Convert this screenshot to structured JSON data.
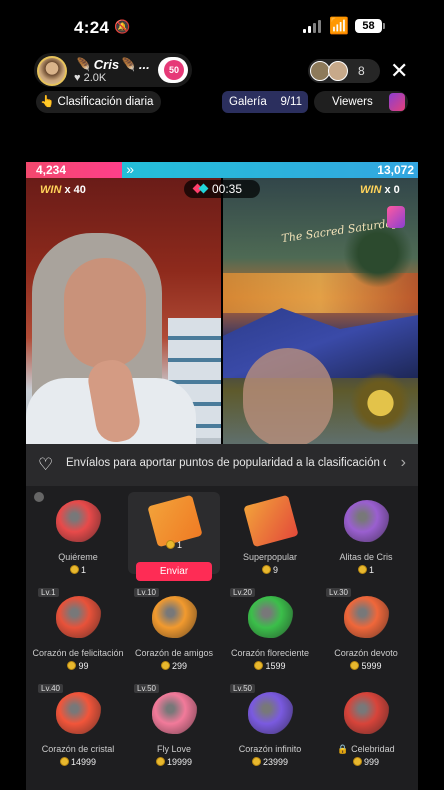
{
  "status_bar": {
    "time": "4:24",
    "battery": "58"
  },
  "host": {
    "name": "🪶 Cris🪶 ...",
    "likes": "♥ 2.0K",
    "badge": "50"
  },
  "viewers": {
    "count": "8"
  },
  "ranking": {
    "label": "👆 Clasificación diaria"
  },
  "gallery": {
    "label": "Galería",
    "progress": "9/11"
  },
  "viewers_pill": {
    "label": "Viewers"
  },
  "battle": {
    "left_score": "4,234",
    "right_score": "13,072",
    "left_share": 0.245,
    "timer": "00:35",
    "left_win_label": "WIN",
    "left_win_count": "x 40",
    "right_win_label": "WIN",
    "right_win_count": "x 0",
    "painting_text": "The Sacred Saturday"
  },
  "panel": {
    "info": "Envíalos para aportar puntos de popularidad a la clasificación d",
    "send_label": "Enviar",
    "gifts": [
      {
        "name": "Quiéreme",
        "price": "1",
        "level": "",
        "icon": "heart-face-icon",
        "color": "#e84a4a"
      },
      {
        "name": "",
        "price": "1",
        "level": "",
        "icon": "popular-arrow-icon",
        "color": "#f07b24",
        "selected": true
      },
      {
        "name": "Superpopular",
        "price": "9",
        "level": "",
        "icon": "super-popular-icon",
        "color": "#e34a3a"
      },
      {
        "name": "Alitas de Cris",
        "price": "1",
        "level": "",
        "icon": "winged-heart-icon",
        "color": "#9a5fd0"
      },
      {
        "name": "Corazón de felicitación",
        "price": "99",
        "level": "Lv.1",
        "icon": "congrats-heart-icon",
        "color": "#e8523a"
      },
      {
        "name": "Corazón de amigos",
        "price": "299",
        "level": "Lv.10",
        "icon": "friends-heart-icon",
        "color": "#f29a2e"
      },
      {
        "name": "Corazón floreciente",
        "price": "1599",
        "level": "Lv.20",
        "icon": "blooming-heart-icon",
        "color": "#3bbf4a"
      },
      {
        "name": "Corazón devoto",
        "price": "5999",
        "level": "Lv.30",
        "icon": "devoted-heart-icon",
        "color": "#f0673a"
      },
      {
        "name": "Corazón de cristal",
        "price": "14999",
        "level": "Lv.40",
        "icon": "crystal-heart-icon",
        "color": "#f2553a"
      },
      {
        "name": "Fly Love",
        "price": "19999",
        "level": "Lv.50",
        "icon": "fly-love-icon",
        "color": "#f27a9a"
      },
      {
        "name": "Corazón infinito",
        "price": "23999",
        "level": "Lv.50",
        "icon": "infinite-heart-icon",
        "color": "#7a5ae0"
      },
      {
        "name": "🔒 Celebridad",
        "price": "999",
        "level": "",
        "icon": "celebrity-heart-icon",
        "color": "#d8443a"
      }
    ]
  }
}
